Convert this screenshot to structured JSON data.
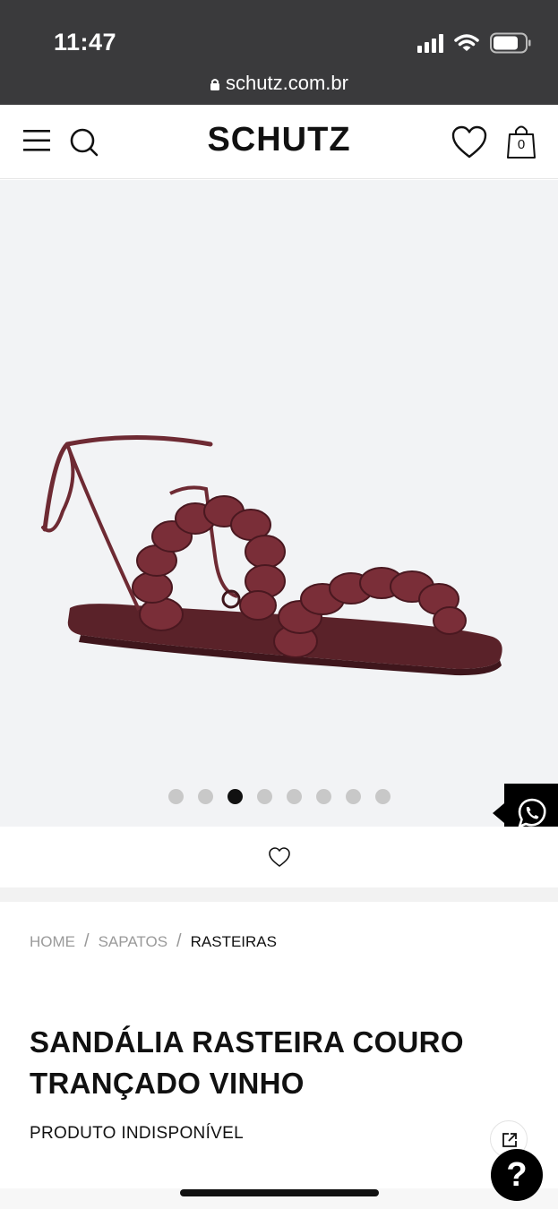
{
  "status_bar": {
    "time": "11:47",
    "url": "schutz.com.br",
    "icons": [
      "signal-icon",
      "wifi-icon",
      "battery-icon",
      "lock-icon"
    ]
  },
  "header": {
    "brand": "SCHUTZ",
    "bag_count": "0",
    "icons": [
      "menu-icon",
      "search-icon",
      "heart-icon",
      "bag-icon"
    ]
  },
  "gallery": {
    "total_images": 8,
    "active_index": 2,
    "icons": [
      "whatsapp-icon"
    ]
  },
  "favorite": {
    "icons": [
      "heart-outline-icon"
    ]
  },
  "breadcrumb": {
    "items": [
      {
        "label": "HOME"
      },
      {
        "label": "SAPATOS"
      },
      {
        "label": "RASTEIRAS"
      }
    ],
    "separator": "/"
  },
  "product": {
    "title": "SANDÁLIA RASTEIRA COURO TRANÇADO VINHO",
    "availability": "PRODUTO INDISPONÍVEL"
  },
  "help": {
    "label": "?"
  },
  "colors": {
    "status_bar": "#3a3a3c",
    "gallery_bg": "#f2f3f5",
    "product_leather": "#6e2a33",
    "dot_active": "#111111",
    "dot_inactive": "#c8c8c8"
  }
}
